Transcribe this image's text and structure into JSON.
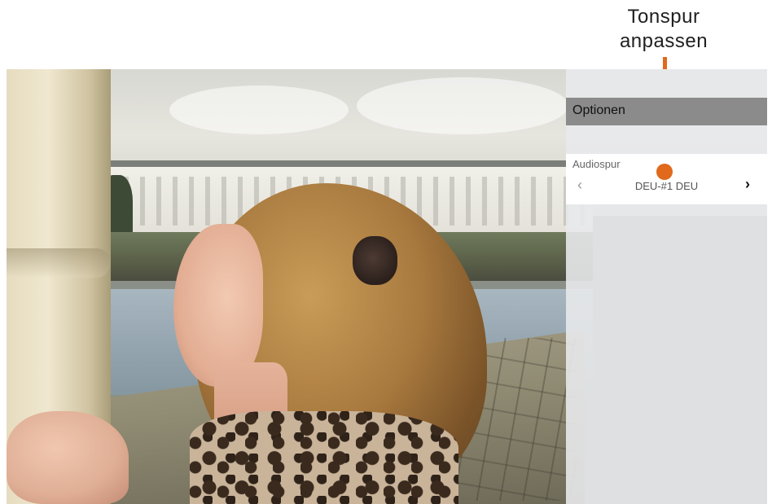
{
  "annotation": {
    "label": "Tonspur anpassen",
    "color": "#e0691c"
  },
  "panel": {
    "title": "Optionen",
    "audio_track": {
      "label": "Audiospur",
      "value": "DEU-#1 DEU",
      "prev_icon": "‹",
      "next_icon": "›"
    }
  }
}
